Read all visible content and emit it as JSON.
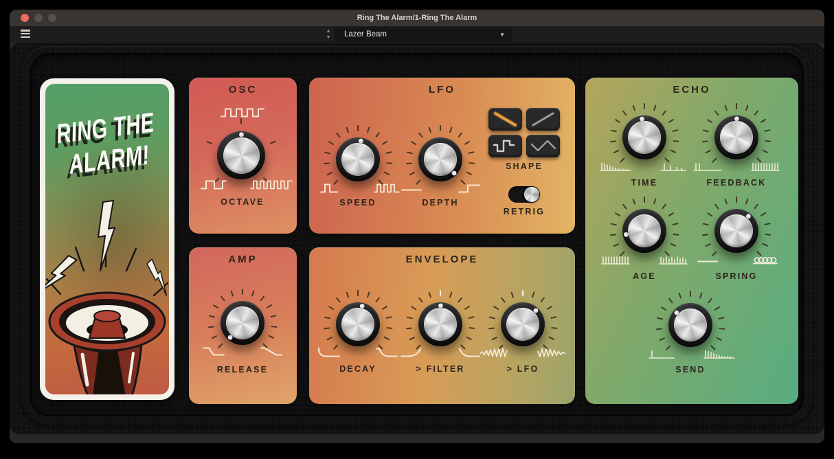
{
  "window": {
    "title": "Ring The Alarm/1-Ring The Alarm",
    "traffic_light_colors": [
      "#ed6a5f",
      "#57504b",
      "#57504b"
    ]
  },
  "toolbar": {
    "menu_icon": "hamburger-icon",
    "preset_value": "Lazer Beam",
    "stepper_up": "▲",
    "stepper_down": "▼",
    "dropdown_caret": "▼"
  },
  "artwork": {
    "headline_line1": "RING THE",
    "headline_line2": "ALARM!",
    "illustration": "megaphone-with-lightning-bolts"
  },
  "panels": {
    "osc": {
      "title": "OSC"
    },
    "lfo": {
      "title": "LFO"
    },
    "amp": {
      "title": "AMP"
    },
    "envelope": {
      "title": "ENVELOPE"
    },
    "echo": {
      "title": "ECHO"
    }
  },
  "knobs": {
    "octave": {
      "label": "OCTAVE",
      "angle": 0,
      "ticks": 5,
      "icon_top": "square-wave-medium",
      "icon_left": "square-wave-slow",
      "icon_right": "square-wave-fast"
    },
    "speed": {
      "label": "SPEED",
      "angle": 8,
      "ticks": 15,
      "icon_left": "pulse-slow",
      "icon_right": "pulse-fast"
    },
    "depth": {
      "label": "DEPTH",
      "angle": 135,
      "ticks": 15,
      "icon_left": "flat-line",
      "icon_right": "step-up"
    },
    "release": {
      "label": "RELEASE",
      "angle": -138,
      "ticks": 15,
      "icon_left": "ramp-down-fast",
      "icon_right": "ramp-down-slow"
    },
    "decay": {
      "label": "DECAY",
      "angle": 12,
      "ticks": 15,
      "icon_left": "decay-fast",
      "icon_right": "decay-slow"
    },
    "env_filter": {
      "label": "> FILTER",
      "angle": 0,
      "ticks": 15,
      "center_marker": true,
      "icon_left": "rise-curve",
      "icon_right": "decay-curve"
    },
    "env_lfo": {
      "label": "> LFO",
      "angle": 42,
      "ticks": 15,
      "center_marker": true,
      "icon_left": "wave-grow",
      "icon_right": "wave-shrink"
    },
    "time": {
      "label": "TIME",
      "angle": -8,
      "ticks": 15,
      "icon_left": "ticks-dense-fade",
      "icon_right": "ticks-sparse"
    },
    "feedback": {
      "label": "FEEDBACK",
      "angle": 0,
      "ticks": 15,
      "icon_left": "ticks-few",
      "icon_right": "comb-full"
    },
    "age": {
      "label": "AGE",
      "angle": -100,
      "ticks": 15,
      "icon_left": "comb-new",
      "icon_right": "comb-worn"
    },
    "spring": {
      "label": "SPRING",
      "angle": 38,
      "ticks": 15,
      "icon_left": "flat-line",
      "icon_right": "spring-coil"
    },
    "send": {
      "label": "SEND",
      "angle": -48,
      "ticks": 15,
      "icon_left": "tick-one",
      "icon_right": "ticks-dense-fade"
    }
  },
  "lfo_shape": {
    "label": "SHAPE",
    "selected": "saw-down",
    "options": [
      "saw-down",
      "saw-up",
      "square",
      "triangle"
    ]
  },
  "lfo_retrig": {
    "label": "RETRIG",
    "on": true
  },
  "colors": {
    "shape_selected_accent": "#f2a840",
    "panel_text": "#2b241c",
    "icon_stroke": "#f7eedd",
    "titlebar_bg": "#3a3531",
    "toolbar_bg": "#1d1d1f"
  }
}
